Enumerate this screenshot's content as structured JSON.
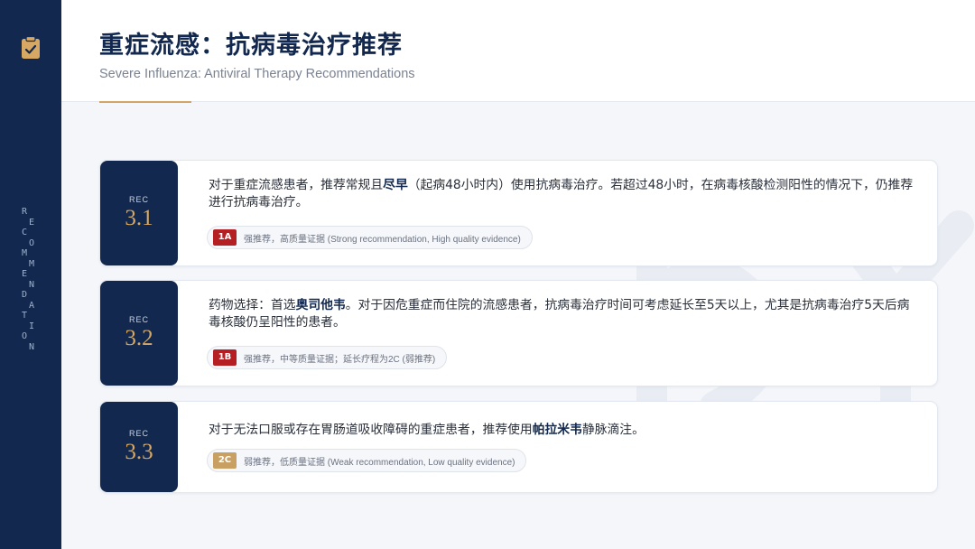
{
  "sidebar": {
    "vertical_letters": [
      "R",
      "E",
      "C",
      "O",
      "M",
      "M",
      "E",
      "N",
      "D",
      "A",
      "T",
      "I",
      "O",
      "N"
    ]
  },
  "header": {
    "title": "重症流感：抗病毒治疗推荐",
    "subtitle": "Severe Influenza: Antiviral Therapy Recommendations"
  },
  "colors": {
    "navy": "#12284e",
    "gold": "#d6a863",
    "grade_red": "#b51f24",
    "grade_gold": "#c9a063"
  },
  "recommendations": [
    {
      "rec_label": "REC",
      "number": "3.1",
      "text_before": "对于重症流感患者，推荐常规且",
      "text_bold": "尽早",
      "text_after": "（起病48小时内）使用抗病毒治疗。若超过48小时，在病毒核酸检测阳性的情况下，仍推荐进行抗病毒治疗。",
      "grade": "1A",
      "grade_text": "强推荐，高质量证据 (Strong recommendation, High quality evidence)"
    },
    {
      "rec_label": "REC",
      "number": "3.2",
      "text_before": "药物选择：首选",
      "text_bold": "奥司他韦",
      "text_after": "。对于因危重症而住院的流感患者，抗病毒治疗时间可考虑延长至5天以上，尤其是抗病毒治疗5天后病毒核酸仍呈阳性的患者。",
      "grade": "1B",
      "grade_text": "强推荐，中等质量证据；延长疗程为2C (弱推荐)"
    },
    {
      "rec_label": "REC",
      "number": "3.3",
      "text_before": "对于无法口服或存在胃肠道吸收障碍的重症患者，推荐使用",
      "text_bold": "帕拉米韦",
      "text_after": "静脉滴注。",
      "grade": "2C",
      "grade_text": "弱推荐，低质量证据 (Weak recommendation, Low quality evidence)"
    }
  ]
}
